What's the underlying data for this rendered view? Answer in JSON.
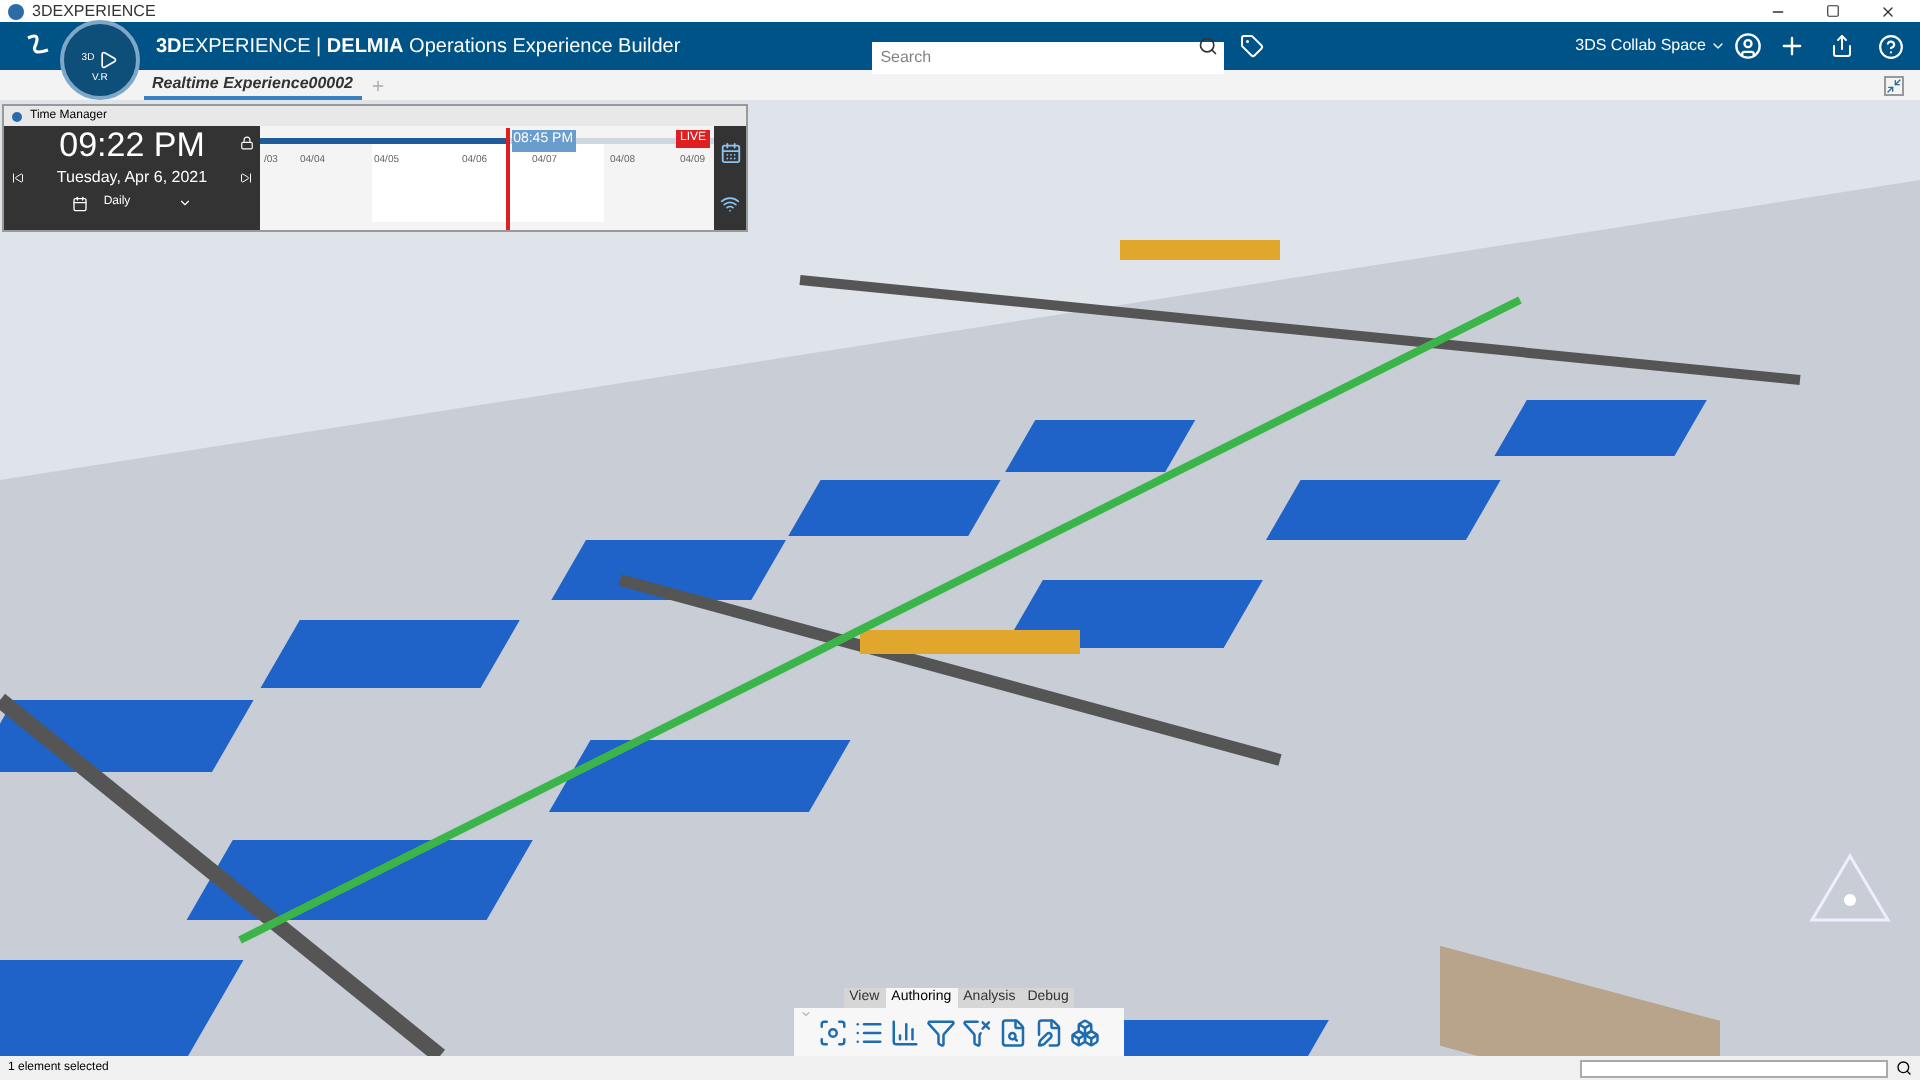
{
  "window": {
    "title": "3DEXPERIENCE"
  },
  "header": {
    "brand": "**3D**EXPERIENCE | **DELMIA** Operations Experience Builder",
    "compass_labels": [
      "3D",
      "V.R"
    ],
    "search": {
      "placeholder": "Search"
    },
    "collab_space": "3DS Collab Space"
  },
  "tabs": [
    {
      "label": "Realtime Experience00002",
      "selected": true
    }
  ],
  "time_manager": {
    "title": "Time Manager",
    "time": "09:22 PM",
    "date": "Tuesday, Apr 6, 2021",
    "period": "Daily",
    "cursor_time": "08:45 PM",
    "live": "LIVE",
    "level": 0.54,
    "ticks": [
      "/03",
      "04/04",
      "04/05",
      "04/06",
      "04/07",
      "04/08",
      "04/09"
    ]
  },
  "toolbar": {
    "tabs": [
      {
        "label": "View",
        "selected": false
      },
      {
        "label": "Authoring",
        "selected": true
      },
      {
        "label": "Analysis",
        "selected": false
      },
      {
        "label": "Debug",
        "selected": false
      }
    ]
  },
  "status_bar": {
    "text": "1 element selected"
  }
}
